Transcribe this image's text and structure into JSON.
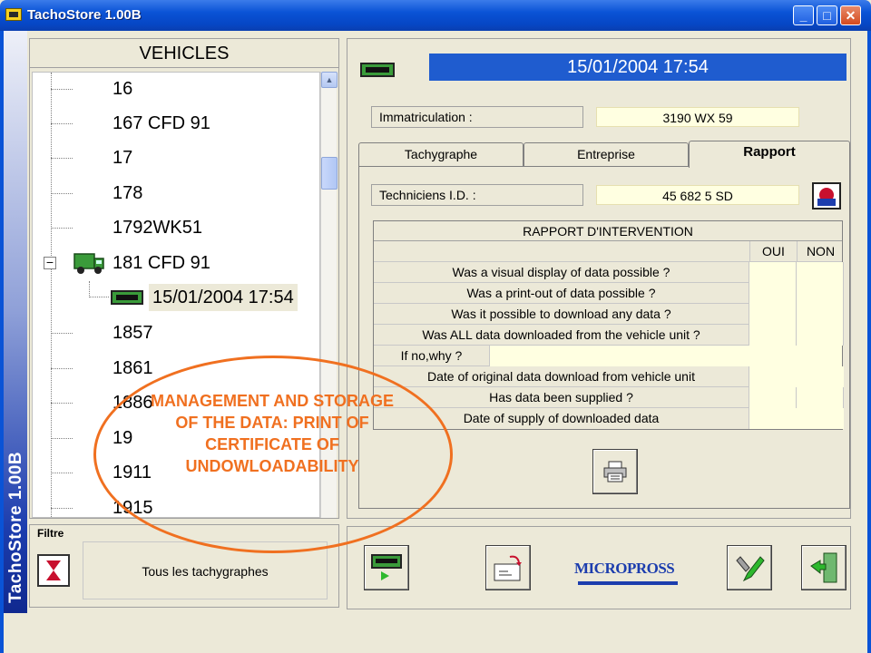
{
  "window": {
    "title": "TachoStore 1.00B",
    "banner": "TachoStore 1.00B"
  },
  "vehicles": {
    "header": "VEHICLES",
    "items": [
      "16",
      "167 CFD 91",
      "17",
      "178",
      "1792WK51",
      "181 CFD 91",
      "1857",
      "1861",
      "1886",
      "19",
      "1911",
      "1915"
    ],
    "selected_download": "15/01/2004 17:54"
  },
  "filter": {
    "label": "Filtre",
    "value": "Tous les tachygraphes"
  },
  "detail": {
    "date": "15/01/2004 17:54",
    "immatriculation_label": "Immatriculation :",
    "immatriculation_value": "3190 WX 59",
    "tabs": [
      "Tachygraphe",
      "Entreprise",
      "Rapport"
    ],
    "active_tab": "Rapport",
    "technicians_label": "Techniciens I.D. :",
    "technicians_value": "45 682 5 SD"
  },
  "report": {
    "title": "RAPPORT D'INTERVENTION",
    "col_yes": "OUI",
    "col_no": "NON",
    "questions": [
      "Was a visual display of data possible ?",
      "Was a print-out of data possible ?",
      "Was it possible to download any data ?",
      "Was ALL data downloaded from the vehicle unit ?"
    ],
    "why_label": "If no,why ?",
    "original_download": "Date of original data download from vehicle unit",
    "supplied": "Has data been supplied ?",
    "supply_date": "Date of supply of downloaded data"
  },
  "toolbar": {
    "logo": "MICROPROSS"
  },
  "annotation": {
    "text": "MANAGEMENT AND STORAGE OF THE DATA: PRINT OF CERTIFICATE OF UNDOWLOADABILITY"
  },
  "colors": {
    "accent_blue": "#1f5ccf",
    "field_yellow": "#ffffe1",
    "annotation_orange": "#f07020"
  },
  "icons": {
    "tacho": "tachograph-icon",
    "truck": "truck-icon",
    "printer": "printer-icon",
    "technician": "technician-icon",
    "filter": "hourglass-icon"
  }
}
